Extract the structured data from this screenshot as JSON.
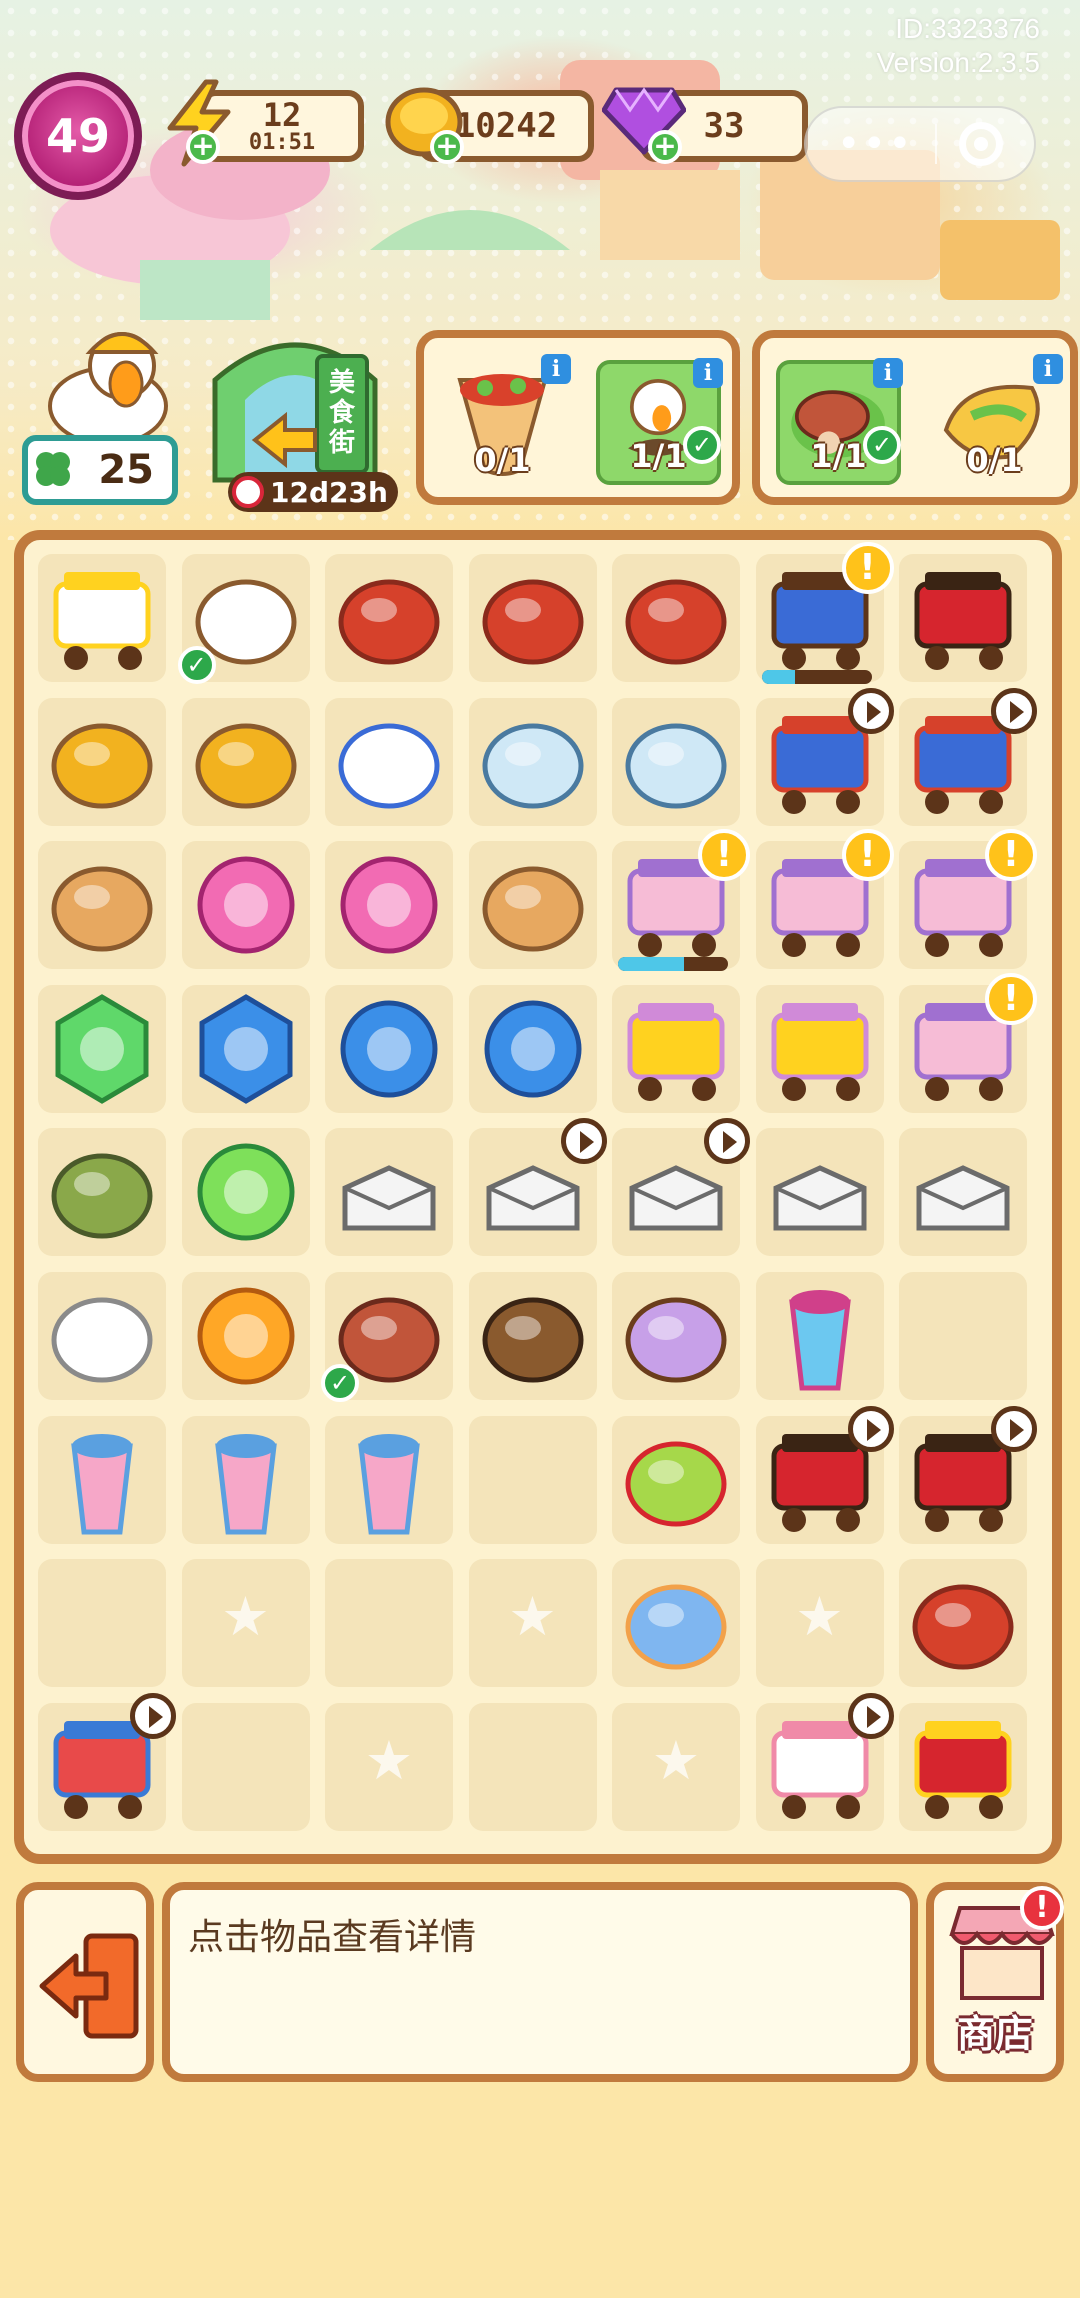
{
  "meta": {
    "id_label": "ID:3323376",
    "version_label": "Version:2.3.5"
  },
  "hud": {
    "level": "49",
    "energy": {
      "value": "12",
      "timer": "01:51",
      "icon": "lightning-icon"
    },
    "coins": {
      "value": "10242",
      "icon": "coin-icon"
    },
    "gems": {
      "value": "33",
      "icon": "gem-icon"
    },
    "capsule": {
      "more_icon": "more-dots-icon",
      "close_icon": "target-ring-icon"
    }
  },
  "helper": {
    "count": "25",
    "icon": "clover-icon"
  },
  "event": {
    "title": "美食街",
    "timer": "12d23h"
  },
  "orders": [
    {
      "items": [
        {
          "progress": "0/1",
          "done": false,
          "icon": "burrito-icon"
        },
        {
          "progress": "1/1",
          "done": true,
          "icon": "duck-plate-icon"
        }
      ]
    },
    {
      "items": [
        {
          "progress": "1/1",
          "done": true,
          "icon": "steak-platter-icon"
        },
        {
          "progress": "0/1",
          "done": false,
          "icon": "omelette-icon"
        }
      ]
    }
  ],
  "board": {
    "rows": [
      [
        "duck-generator-icon",
        "duck-plate-icon",
        "lobster-icon",
        "lobster-icon",
        "lobster-icon",
        "grill-cart-icon",
        "bbq-grill-icon"
      ],
      [
        "coin-stack-icon",
        "coin-stack-icon",
        "megaphone-icon",
        "seed-packet-icon",
        "seed-packet-icon",
        "lobster-cart-icon",
        "lobster-cart-icon"
      ],
      [
        "flatbread-icon",
        "pink-scissors-icon",
        "pink-scissors-icon",
        "flatbread-stack-icon",
        "ice-cream-cart-icon",
        "ice-cream-cart-icon",
        "ice-cream-cart-icon"
      ],
      [
        "green-hex-gem-icon",
        "blue-hex-gem-icon",
        "blue-scissors-icon",
        "blue-scissors-icon",
        "drink-stall-icon",
        "drink-stall-icon",
        "ice-cream-cart-icon"
      ],
      [
        "backpack-icon",
        "green-energy-icon",
        "takeout-box-icon",
        "chicken-box-icon",
        "chicken-box-icon",
        "noodle-box-icon",
        "takeout-box-icon"
      ],
      [
        "dough-icon",
        "orange-energy-icon",
        "steak-platter-icon",
        "skewer-platter-icon",
        "string-lights-icon",
        "shaved-ice-icon",
        ""
      ],
      [
        "rainbow-drink-icon",
        "rainbow-drink-icon",
        "rainbow-drink-icon",
        "",
        "fruit-basket-icon",
        "bbq-grill-icon",
        "bbq-grill-icon"
      ],
      [
        "",
        "locked",
        "",
        "locked",
        "bunting-flags-icon",
        "locked",
        "lobster-icon"
      ],
      [
        "delivery-truck-icon",
        "",
        "locked",
        "",
        "locked",
        "food-truck-icon",
        "energy-generator-icon"
      ]
    ],
    "energy_bar_levels": {
      "grill_cart": 0.3,
      "ice_cream_cart": 0.6
    }
  },
  "bottom": {
    "hint": "点击物品查看详情",
    "exit_icon": "exit-door-icon",
    "shop_label": "商店",
    "shop_icon": "shop-stall-icon"
  },
  "colors": {
    "frame": "#c07a3d",
    "cell": "#f4e4ba",
    "done_green": "#8ed86a",
    "level_pink": "#b21e74"
  }
}
